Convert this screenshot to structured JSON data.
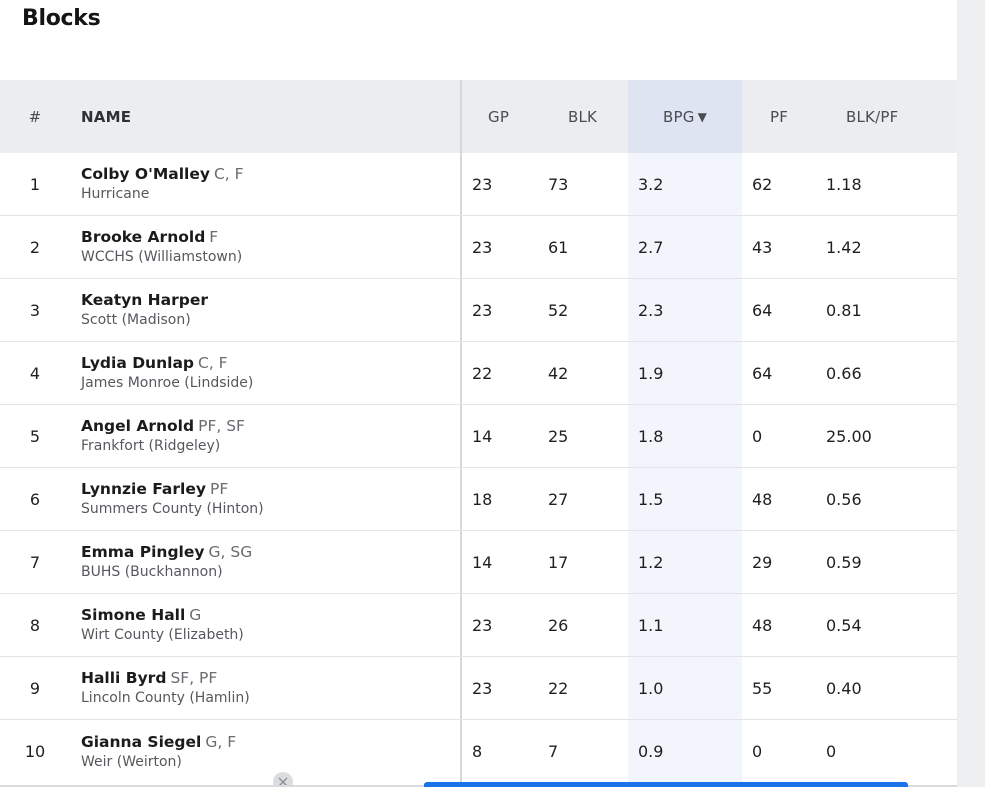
{
  "title": "Blocks",
  "columns": {
    "rank": "#",
    "name": "NAME",
    "gp": "GP",
    "blk": "BLK",
    "bpg": "BPG",
    "pf": "PF",
    "ratio": "BLK/PF"
  },
  "sort": {
    "column": "BPG",
    "direction": "descending",
    "icon": "sort-down-icon"
  },
  "rows": [
    {
      "rank": "1",
      "name": "Colby O'Malley",
      "pos": "C, F",
      "school": "Hurricane",
      "gp": "23",
      "blk": "73",
      "bpg": "3.2",
      "pf": "62",
      "ratio": "1.18"
    },
    {
      "rank": "2",
      "name": "Brooke Arnold",
      "pos": "F",
      "school": "WCCHS (Williamstown)",
      "gp": "23",
      "blk": "61",
      "bpg": "2.7",
      "pf": "43",
      "ratio": "1.42"
    },
    {
      "rank": "3",
      "name": "Keatyn Harper",
      "pos": "",
      "school": "Scott (Madison)",
      "gp": "23",
      "blk": "52",
      "bpg": "2.3",
      "pf": "64",
      "ratio": "0.81"
    },
    {
      "rank": "4",
      "name": "Lydia Dunlap",
      "pos": "C, F",
      "school": "James Monroe (Lindside)",
      "gp": "22",
      "blk": "42",
      "bpg": "1.9",
      "pf": "64",
      "ratio": "0.66"
    },
    {
      "rank": "5",
      "name": "Angel Arnold",
      "pos": "PF, SF",
      "school": "Frankfort (Ridgeley)",
      "gp": "14",
      "blk": "25",
      "bpg": "1.8",
      "pf": "0",
      "ratio": "25.00"
    },
    {
      "rank": "6",
      "name": "Lynnzie Farley",
      "pos": "PF",
      "school": "Summers County (Hinton)",
      "gp": "18",
      "blk": "27",
      "bpg": "1.5",
      "pf": "48",
      "ratio": "0.56"
    },
    {
      "rank": "7",
      "name": "Emma Pingley",
      "pos": "G, SG",
      "school": "BUHS (Buckhannon)",
      "gp": "14",
      "blk": "17",
      "bpg": "1.2",
      "pf": "29",
      "ratio": "0.59"
    },
    {
      "rank": "8",
      "name": "Simone Hall",
      "pos": "G",
      "school": "Wirt County (Elizabeth)",
      "gp": "23",
      "blk": "26",
      "bpg": "1.1",
      "pf": "48",
      "ratio": "0.54"
    },
    {
      "rank": "9",
      "name": "Halli Byrd",
      "pos": "SF, PF",
      "school": "Lincoln County (Hamlin)",
      "gp": "23",
      "blk": "22",
      "bpg": "1.0",
      "pf": "55",
      "ratio": "0.40"
    },
    {
      "rank": "10",
      "name": "Gianna Siegel",
      "pos": "G, F",
      "school": "Weir (Weirton)",
      "gp": "8",
      "blk": "7",
      "bpg": "0.9",
      "pf": "0",
      "ratio": "0"
    }
  ],
  "colors": {
    "header_bg": "#ecedf0",
    "sorted_header_bg": "#dfe4f3",
    "sorted_column_bg": "#f2f5fc",
    "accent_bar": "#1a73e8"
  }
}
